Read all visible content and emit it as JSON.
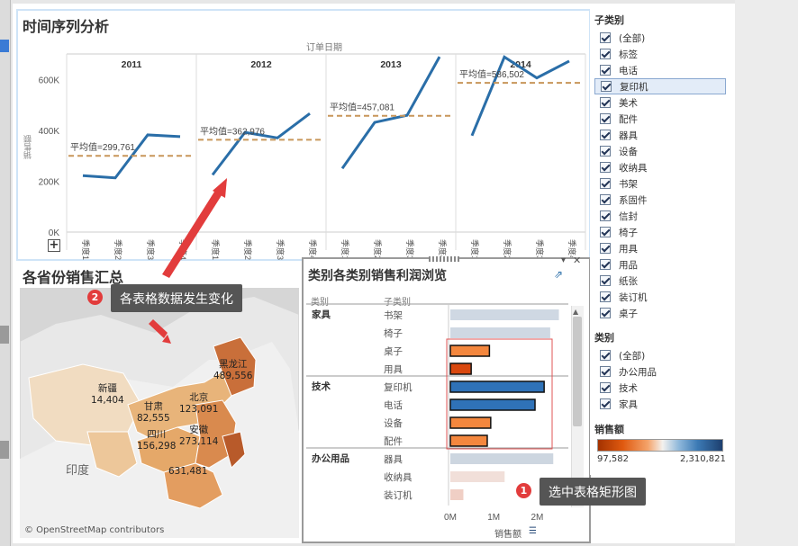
{
  "ts_panel": {
    "title": "时间序列分析",
    "axis_title": "订单日期",
    "ylabel": "销售额",
    "years": [
      "2011",
      "2012",
      "2013",
      "2014"
    ],
    "yticks": [
      "600K",
      "400K",
      "200K",
      "0K"
    ],
    "avg_labels": [
      "平均值=299,761",
      "平均值=362,976",
      "平均值=457,081",
      "平均值=586,502"
    ],
    "quarters": [
      "季度1",
      "季度2",
      "季度3",
      "季度4"
    ],
    "expand_button": "+"
  },
  "chart_data": [
    {
      "type": "line",
      "title": "时间序列分析",
      "xlabel": "订单日期",
      "ylabel": "销售额",
      "ylim": [
        0,
        700000
      ],
      "categories": [
        "2011 季度1",
        "2011 季度2",
        "2011 季度3",
        "2011 季度4",
        "2012 季度1",
        "2012 季度2",
        "2012 季度3",
        "2012 季度4",
        "2013 季度1",
        "2013 季度2",
        "2013 季度3",
        "2013 季度4",
        "2014 季度1",
        "2014 季度2",
        "2014 季度3",
        "2014 季度4"
      ],
      "series": [
        {
          "values": [
            222000,
            213000,
            382000,
            375000,
            225000,
            392000,
            370000,
            466000,
            250000,
            431000,
            459000,
            689000,
            379000,
            688000,
            606000,
            672000
          ]
        }
      ],
      "reference_lines": [
        {
          "label": "平均值=299,761",
          "value": 299761
        },
        {
          "label": "平均值=362,976",
          "value": 362976
        },
        {
          "label": "平均值=457,081",
          "value": 457081
        },
        {
          "label": "平均值=586,502",
          "value": 586502
        }
      ],
      "grid": false,
      "legend": "none"
    },
    {
      "type": "bar",
      "title": "类别各类别销售利润浏览",
      "xlabel": "销售额",
      "categories": [
        "书架",
        "椅子",
        "桌子",
        "用具",
        "复印机",
        "电话",
        "设备",
        "配件",
        "器具",
        "收纳具",
        "装订机"
      ],
      "values": [
        2500000,
        2300000,
        900000,
        480000,
        2160000,
        1950000,
        930000,
        850000,
        2370000,
        1250000,
        300000
      ],
      "xlim": [
        0,
        2800000
      ],
      "xticks": [
        "0M",
        "1M",
        "2M"
      ],
      "legend": "none"
    }
  ],
  "map_panel": {
    "title": "各省份销售汇总",
    "attribution": "© OpenStreetMap contributors",
    "labels": [
      {
        "name": "新疆",
        "value": "14,404"
      },
      {
        "name": "甘肃",
        "value": "82,555"
      },
      {
        "name": "北京",
        "value": "123,091"
      },
      {
        "name": "四川",
        "value": "156,298"
      },
      {
        "name": "黑龙江",
        "value": "489,556"
      },
      {
        "name": "安徽",
        "value": "273,114"
      },
      {
        "name": "",
        "value": "631,481"
      }
    ],
    "country_label": "印度"
  },
  "bar_panel": {
    "title": "类别各类别销售利润浏览",
    "col_category": "类别",
    "col_subcategory": "子类别",
    "groups": [
      {
        "name": "家具",
        "items": [
          "书架",
          "椅子",
          "桌子",
          "用具"
        ]
      },
      {
        "name": "技术",
        "items": [
          "复印机",
          "电话",
          "设备",
          "配件"
        ]
      },
      {
        "name": "办公用品",
        "items": [
          "器具",
          "收纳具",
          "装订机"
        ]
      }
    ],
    "xaxis_label": "销售额",
    "xticks": [
      "0M",
      "1M",
      "2M"
    ]
  },
  "filters": {
    "subcat_title": "子类别",
    "subcat_items": [
      "(全部)",
      "标签",
      "电话",
      "复印机",
      "美术",
      "配件",
      "器具",
      "设备",
      "收纳具",
      "书架",
      "系固件",
      "信封",
      "椅子",
      "用具",
      "用品",
      "纸张",
      "装订机",
      "桌子"
    ],
    "cat_title": "类别",
    "cat_items": [
      "(全部)",
      "办公用品",
      "技术",
      "家具"
    ],
    "legend_title": "销售额",
    "legend_min": "97,582",
    "legend_max": "2,310,821"
  },
  "annotations": {
    "badge1": "1",
    "callout1": "选中表格矩形图",
    "badge2": "2",
    "callout2": "各表格数据发生变化"
  },
  "colors": {
    "line": "#2a6ea8",
    "avg": "#c8965a",
    "selected_orange": "#f4873e",
    "selected_blue": "#2f72b8",
    "bar_gray": "#cdd6e0"
  }
}
